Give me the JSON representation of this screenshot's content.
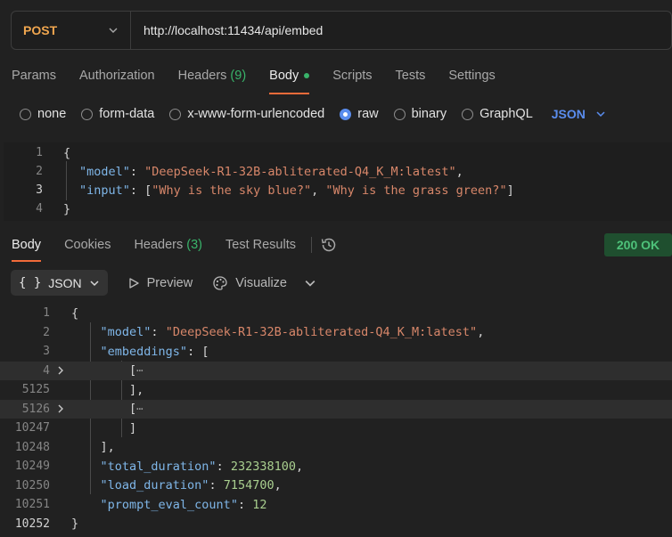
{
  "request": {
    "method": "POST",
    "url": "http://localhost:11434/api/embed"
  },
  "tabs": [
    {
      "label": "Params"
    },
    {
      "label": "Authorization"
    },
    {
      "label": "Headers",
      "count": "(9)"
    },
    {
      "label": "Body"
    },
    {
      "label": "Scripts"
    },
    {
      "label": "Tests"
    },
    {
      "label": "Settings"
    }
  ],
  "body_types": [
    "none",
    "form-data",
    "x-www-form-urlencoded",
    "raw",
    "binary",
    "GraphQL"
  ],
  "selected_body_type": "raw",
  "raw_format": "JSON",
  "request_body": {
    "line_numbers": [
      "1",
      "2",
      "3",
      "4"
    ],
    "open": "{",
    "close": "}",
    "model_key": "\"model\"",
    "model_value": "\"DeepSeek-R1-32B-abliterated-Q4_K_M:latest\"",
    "input_key": "\"input\"",
    "input_value_1": "\"Why is the sky blue?\"",
    "input_value_2": "\"Why is the grass green?\""
  },
  "response_tabs": [
    {
      "label": "Body"
    },
    {
      "label": "Cookies"
    },
    {
      "label": "Headers",
      "count": "(3)"
    },
    {
      "label": "Test Results"
    }
  ],
  "status": "200 OK",
  "response_toolbar": {
    "format_icon": "{ }",
    "format": "JSON",
    "preview": "Preview",
    "visualize": "Visualize"
  },
  "response_body": {
    "line_numbers": [
      "1",
      "2",
      "3",
      "4",
      "5125",
      "5126",
      "10247",
      "10248",
      "10249",
      "10250",
      "10251",
      "10252"
    ],
    "model_key": "\"model\"",
    "model_value": "\"DeepSeek-R1-32B-abliterated-Q4_K_M:latest\"",
    "embeddings_key": "\"embeddings\"",
    "collapsed": "⋯",
    "total_duration_key": "\"total_duration\"",
    "total_duration": "232338100",
    "load_duration_key": "\"load_duration\"",
    "load_duration": "7154700",
    "prompt_eval_count_key": "\"prompt_eval_count\"",
    "prompt_eval_count": "12"
  }
}
